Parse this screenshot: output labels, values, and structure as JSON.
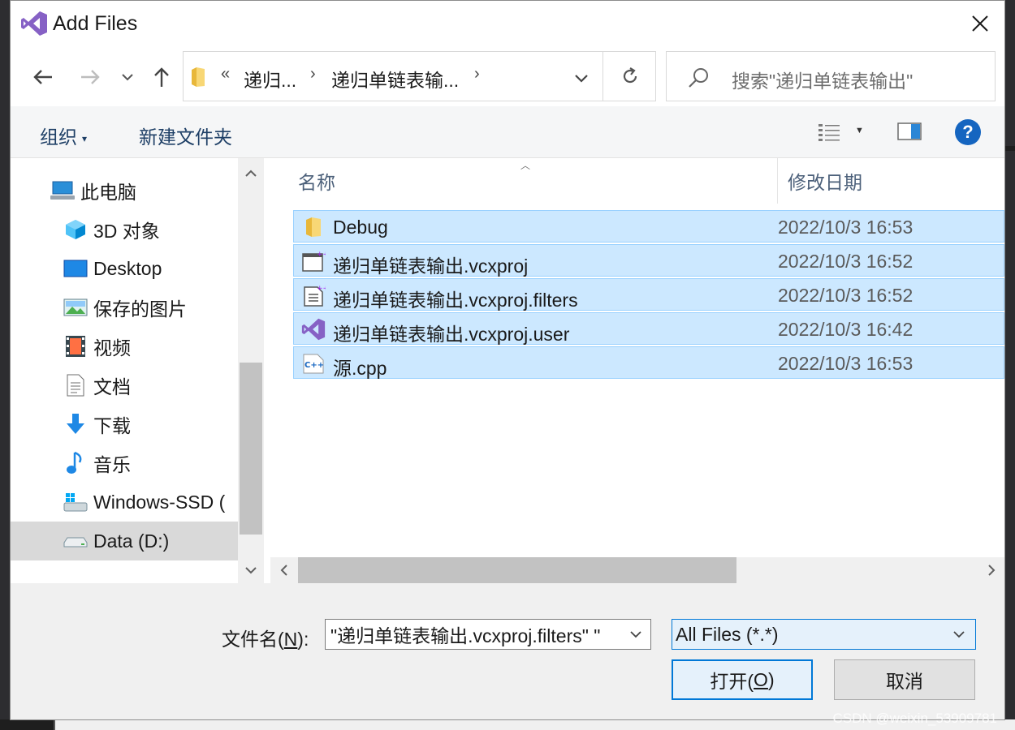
{
  "window": {
    "title": "Add Files"
  },
  "address": {
    "overflow": "«",
    "crumbs": [
      "递归...",
      "递归单链表输..."
    ],
    "separator": "›"
  },
  "search": {
    "placeholder": "搜索\"递归单链表输出\""
  },
  "toolbar": {
    "organize": "组织",
    "new_folder": "新建文件夹"
  },
  "nav": {
    "items": [
      {
        "label": "此电脑",
        "icon": "computer-icon"
      },
      {
        "label": "3D 对象",
        "icon": "3d-objects-icon"
      },
      {
        "label": "Desktop",
        "icon": "desktop-icon"
      },
      {
        "label": "保存的图片",
        "icon": "pictures-icon"
      },
      {
        "label": "视频",
        "icon": "videos-icon"
      },
      {
        "label": "文档",
        "icon": "documents-icon"
      },
      {
        "label": "下载",
        "icon": "downloads-icon"
      },
      {
        "label": "音乐",
        "icon": "music-icon"
      },
      {
        "label": "Windows-SSD (",
        "icon": "windows-drive-icon"
      },
      {
        "label": "Data (D:)",
        "icon": "drive-icon",
        "selected": true
      }
    ]
  },
  "files": {
    "columns": {
      "name": "名称",
      "date": "修改日期"
    },
    "rows": [
      {
        "name": "Debug",
        "date": "2022/10/3 16:53",
        "icon": "folder-icon"
      },
      {
        "name": "递归单链表输出.vcxproj",
        "date": "2022/10/3 16:52",
        "icon": "vcxproj-icon"
      },
      {
        "name": "递归单链表输出.vcxproj.filters",
        "date": "2022/10/3 16:52",
        "icon": "filters-icon"
      },
      {
        "name": "递归单链表输出.vcxproj.user",
        "date": "2022/10/3 16:42",
        "icon": "vs-user-icon"
      },
      {
        "name": "源.cpp",
        "date": "2022/10/3 16:53",
        "icon": "cpp-icon"
      }
    ]
  },
  "bottom": {
    "filename_label_pre": "文件名(",
    "filename_label_key": "N",
    "filename_label_post": "):",
    "filename_value": "\"递归单链表输出.vcxproj.filters\" \"",
    "filetype": "All Files (*.*)",
    "open_pre": "打开(",
    "open_key": "O",
    "open_post": ")",
    "cancel": "取消"
  },
  "watermark": "CSDN @weixin_53909781"
}
